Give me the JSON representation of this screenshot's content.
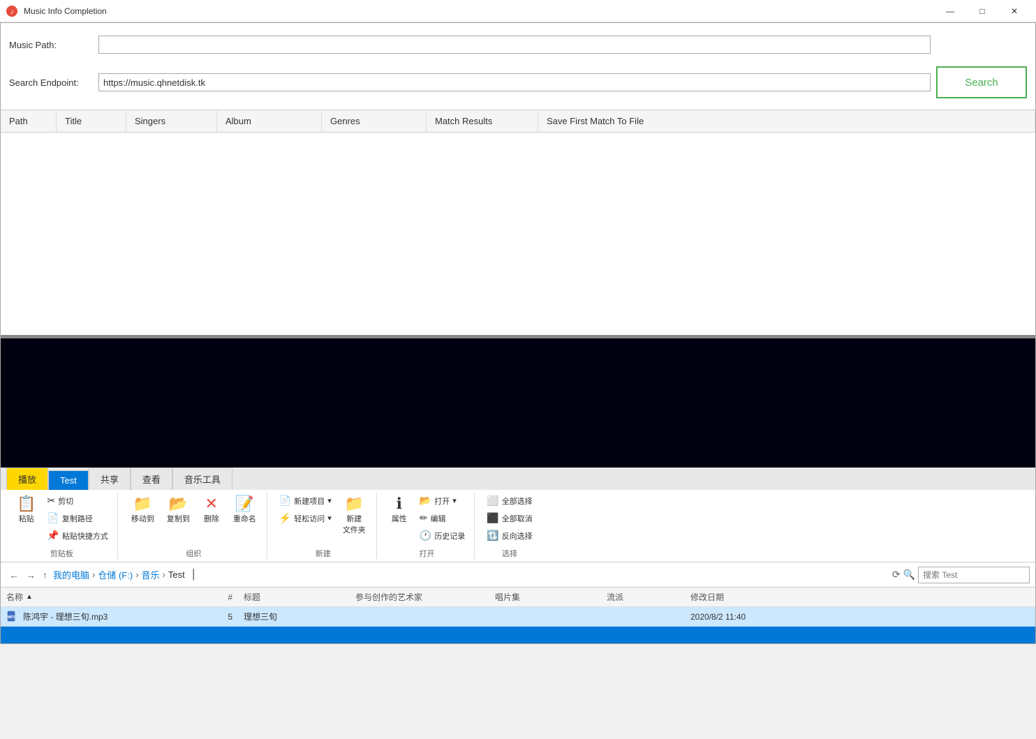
{
  "titleBar": {
    "title": "Music Info Completion",
    "iconColor": "#e74c3c",
    "minimizeLabel": "—",
    "maximizeLabel": "□",
    "closeLabel": "✕"
  },
  "form": {
    "musicPathLabel": "Music Path:",
    "musicPathValue": "",
    "musicPathPlaceholder": "",
    "searchEndpointLabel": "Search Endpoint:",
    "searchEndpointValue": "https://music.qhnetdisk.tk",
    "searchBtnLabel": "Search"
  },
  "tableColumns": {
    "path": "Path",
    "title": "Title",
    "singers": "Singers",
    "album": "Album",
    "genres": "Genres",
    "matchResults": "Match Results",
    "saveFirstMatch": "Save First Match To File"
  },
  "explorer": {
    "tabs": {
      "share": "共享",
      "view": "查看",
      "musicTools": "音乐工具",
      "play": "播放",
      "test": "Test"
    },
    "ribbon": {
      "clipboard": {
        "label": "剪贴板",
        "paste": "粘贴",
        "cut": "剪切",
        "copyPath": "复制路径",
        "pasteShortcut": "粘贴快捷方式"
      },
      "organize": {
        "label": "组织",
        "moveTo": "移动到",
        "copyTo": "复制到",
        "delete": "删除",
        "rename": "重命名"
      },
      "newGroup": {
        "label": "新建",
        "newItem": "新建项目",
        "easyAccess": "轻松访问",
        "newFolder": "新建\n文件夹"
      },
      "properties": {
        "label": "打开",
        "properties": "属性",
        "open": "打开",
        "edit": "编辑",
        "history": "历史记录"
      },
      "selection": {
        "label": "选择",
        "selectAll": "全部选择",
        "deselectAll": "全部取消",
        "invertSelection": "反向选择"
      }
    },
    "addressBar": {
      "path": [
        "我的电脑",
        "仓储 (F:)",
        "音乐",
        "Test"
      ],
      "searchPlaceholder": "搜索 Test"
    },
    "fileList": {
      "columns": {
        "name": "名称",
        "num": "#",
        "title": "标题",
        "artist": "参与创作的艺术家",
        "album": "唱片集",
        "genre": "流派",
        "date": "修改日期"
      },
      "files": [
        {
          "name": "陈鸿宇 - 理想三旬.mp3",
          "type": "mp3",
          "num": "5",
          "title": "理想三旬",
          "artist": "",
          "album": "",
          "genre": "",
          "date": "2020/8/2 11:40"
        }
      ]
    }
  }
}
